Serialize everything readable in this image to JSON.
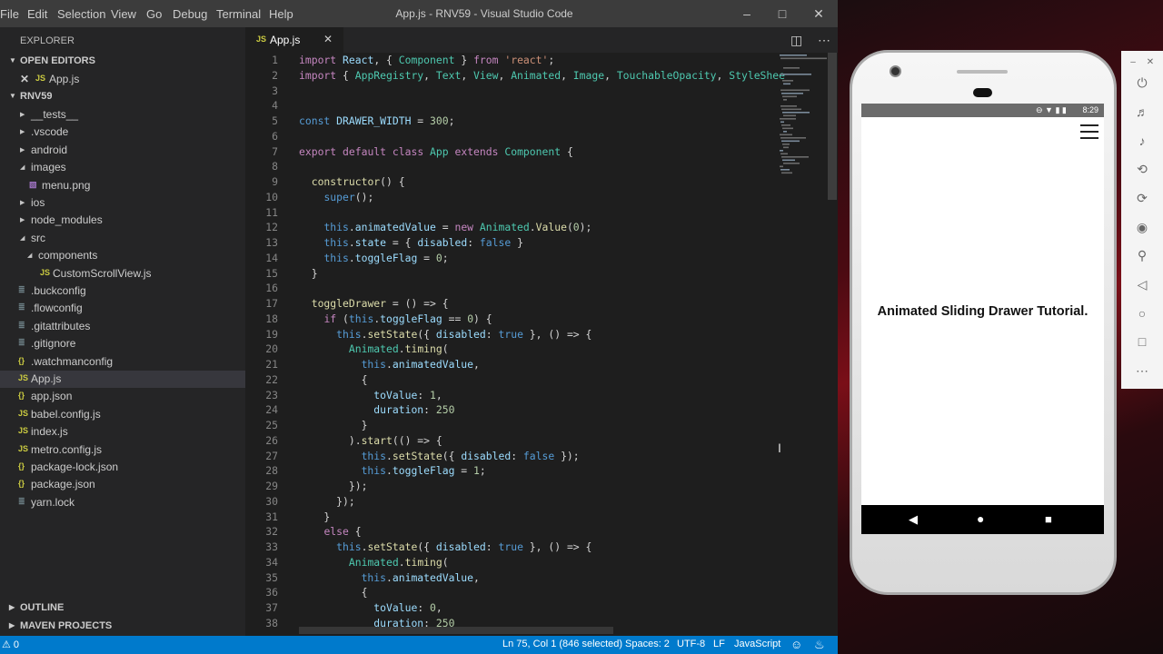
{
  "window": {
    "title": "App.js - RNV59 - Visual Studio Code",
    "menu": [
      "File",
      "Edit",
      "Selection",
      "View",
      "Go",
      "Debug",
      "Terminal",
      "Help"
    ]
  },
  "sidebar": {
    "title": "EXPLORER",
    "open_editors_label": "OPEN EDITORS",
    "open_editor_item": "App.js",
    "project_label": "RNV59",
    "tree": [
      {
        "label": "__tests__",
        "kind": "folder",
        "expanded": false
      },
      {
        "label": ".vscode",
        "kind": "folder",
        "expanded": false
      },
      {
        "label": "android",
        "kind": "folder",
        "expanded": false
      },
      {
        "label": "images",
        "kind": "folder",
        "expanded": true
      },
      {
        "label": "menu.png",
        "kind": "image"
      },
      {
        "label": "ios",
        "kind": "folder",
        "expanded": false
      },
      {
        "label": "node_modules",
        "kind": "folder",
        "expanded": false
      },
      {
        "label": "src",
        "kind": "folder",
        "expanded": true
      },
      {
        "label": "components",
        "kind": "folder",
        "expanded": true
      },
      {
        "label": "CustomScrollView.js",
        "kind": "js"
      },
      {
        "label": ".buckconfig",
        "kind": "config"
      },
      {
        "label": ".flowconfig",
        "kind": "config"
      },
      {
        "label": ".gitattributes",
        "kind": "config"
      },
      {
        "label": ".gitignore",
        "kind": "config"
      },
      {
        "label": ".watchmanconfig",
        "kind": "json"
      },
      {
        "label": "App.js",
        "kind": "js",
        "selected": true
      },
      {
        "label": "app.json",
        "kind": "json"
      },
      {
        "label": "babel.config.js",
        "kind": "js"
      },
      {
        "label": "index.js",
        "kind": "js"
      },
      {
        "label": "metro.config.js",
        "kind": "js"
      },
      {
        "label": "package-lock.json",
        "kind": "json"
      },
      {
        "label": "package.json",
        "kind": "json"
      },
      {
        "label": "yarn.lock",
        "kind": "config"
      }
    ],
    "outline_label": "OUTLINE",
    "maven_label": "MAVEN PROJECTS"
  },
  "editor": {
    "tab_label": "App.js",
    "tab_icon": "JS",
    "lines": [
      {
        "n": "1",
        "text": "import React, { Component } from 'react';"
      },
      {
        "n": "2",
        "text": "import { AppRegistry, Text, View, Animated, Image, TouchableOpacity, StyleShee"
      },
      {
        "n": "3",
        "text": ""
      },
      {
        "n": "4",
        "text": ""
      },
      {
        "n": "5",
        "text": "const DRAWER_WIDTH = 300;"
      },
      {
        "n": "6",
        "text": ""
      },
      {
        "n": "7",
        "text": "export default class App extends Component {"
      },
      {
        "n": "8",
        "text": ""
      },
      {
        "n": "9",
        "text": "  constructor() {"
      },
      {
        "n": "10",
        "text": "    super();"
      },
      {
        "n": "11",
        "text": ""
      },
      {
        "n": "12",
        "text": "    this.animatedValue = new Animated.Value(0);"
      },
      {
        "n": "13",
        "text": "    this.state = { disabled: false }"
      },
      {
        "n": "14",
        "text": "    this.toggleFlag = 0;"
      },
      {
        "n": "15",
        "text": "  }"
      },
      {
        "n": "16",
        "text": ""
      },
      {
        "n": "17",
        "text": "  toggleDrawer = () => {"
      },
      {
        "n": "18",
        "text": "    if (this.toggleFlag == 0) {"
      },
      {
        "n": "19",
        "text": "      this.setState({ disabled: true }, () => {"
      },
      {
        "n": "20",
        "text": "        Animated.timing("
      },
      {
        "n": "21",
        "text": "          this.animatedValue,"
      },
      {
        "n": "22",
        "text": "          {"
      },
      {
        "n": "23",
        "text": "            toValue: 1,"
      },
      {
        "n": "24",
        "text": "            duration: 250"
      },
      {
        "n": "25",
        "text": "          }"
      },
      {
        "n": "26",
        "text": "        ).start(() => {"
      },
      {
        "n": "27",
        "text": "          this.setState({ disabled: false });"
      },
      {
        "n": "28",
        "text": "          this.toggleFlag = 1;"
      },
      {
        "n": "29",
        "text": "        });"
      },
      {
        "n": "30",
        "text": "      });"
      },
      {
        "n": "31",
        "text": "    }"
      },
      {
        "n": "32",
        "text": "    else {"
      },
      {
        "n": "33",
        "text": "      this.setState({ disabled: true }, () => {"
      },
      {
        "n": "34",
        "text": "        Animated.timing("
      },
      {
        "n": "35",
        "text": "          this.animatedValue,"
      },
      {
        "n": "36",
        "text": "          {"
      },
      {
        "n": "37",
        "text": "            toValue: 0,"
      },
      {
        "n": "38",
        "text": "            duration: 250"
      }
    ]
  },
  "statusbar": {
    "problems": "0",
    "cursor": "Ln 75, Col 1 (846 selected)",
    "spaces": "Spaces: 2",
    "encoding": "UTF-8",
    "eol": "LF",
    "language": "JavaScript"
  },
  "emulator": {
    "time": "8:29",
    "app_text": "Animated Sliding Drawer Tutorial."
  },
  "colors": {
    "keyword": "#c586c0",
    "storage": "#569cd6",
    "string": "#ce9178",
    "number": "#b5cea8",
    "class": "#4ec9b0",
    "variable": "#9cdcfe",
    "func": "#dcdcaa",
    "statusbar": "#007acc"
  }
}
